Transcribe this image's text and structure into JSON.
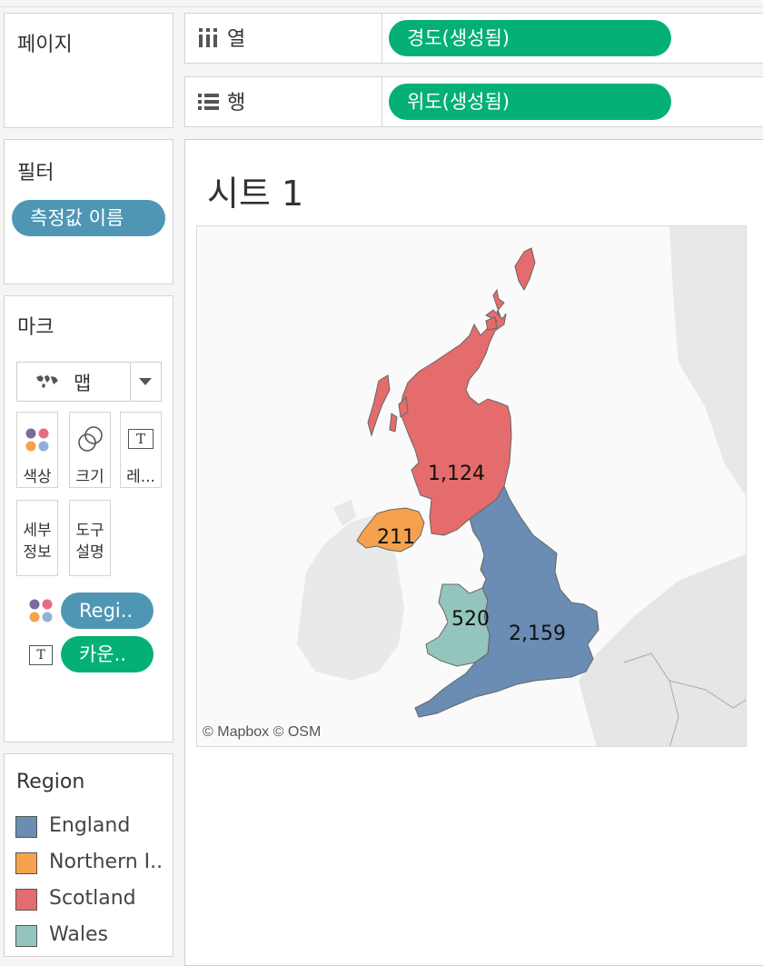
{
  "pages_panel": {
    "title": "페이지"
  },
  "filters_panel": {
    "title": "필터",
    "pill": "측정값 이름"
  },
  "marks_panel": {
    "title": "마크",
    "mark_type": "맵",
    "mark_type_icon": "map-icon",
    "buttons": {
      "color": "색상",
      "size": "크기",
      "label": "레...",
      "detail_1": "세부",
      "detail_2": "정보",
      "tooltip_1": "도구",
      "tooltip_2": "설명"
    },
    "pills": {
      "color_pill": "Regi..",
      "label_pill": "카운.."
    }
  },
  "legend": {
    "title": "Region",
    "items": [
      {
        "label": "England",
        "color": "#6b8cb3"
      },
      {
        "label": "Northern I..",
        "color": "#f5a14e"
      },
      {
        "label": "Scotland",
        "color": "#e46c6c"
      },
      {
        "label": "Wales",
        "color": "#93c5bc"
      }
    ]
  },
  "columns_shelf": {
    "label": "열",
    "pill": "경도(생성됨)"
  },
  "rows_shelf": {
    "label": "행",
    "pill": "위도(생성됨)"
  },
  "sheet": {
    "title": "시트 1"
  },
  "map": {
    "attribution": "© Mapbox © OSM",
    "values": {
      "scotland": "1,124",
      "northern_ireland": "211",
      "wales": "520",
      "england": "2,159"
    }
  }
}
